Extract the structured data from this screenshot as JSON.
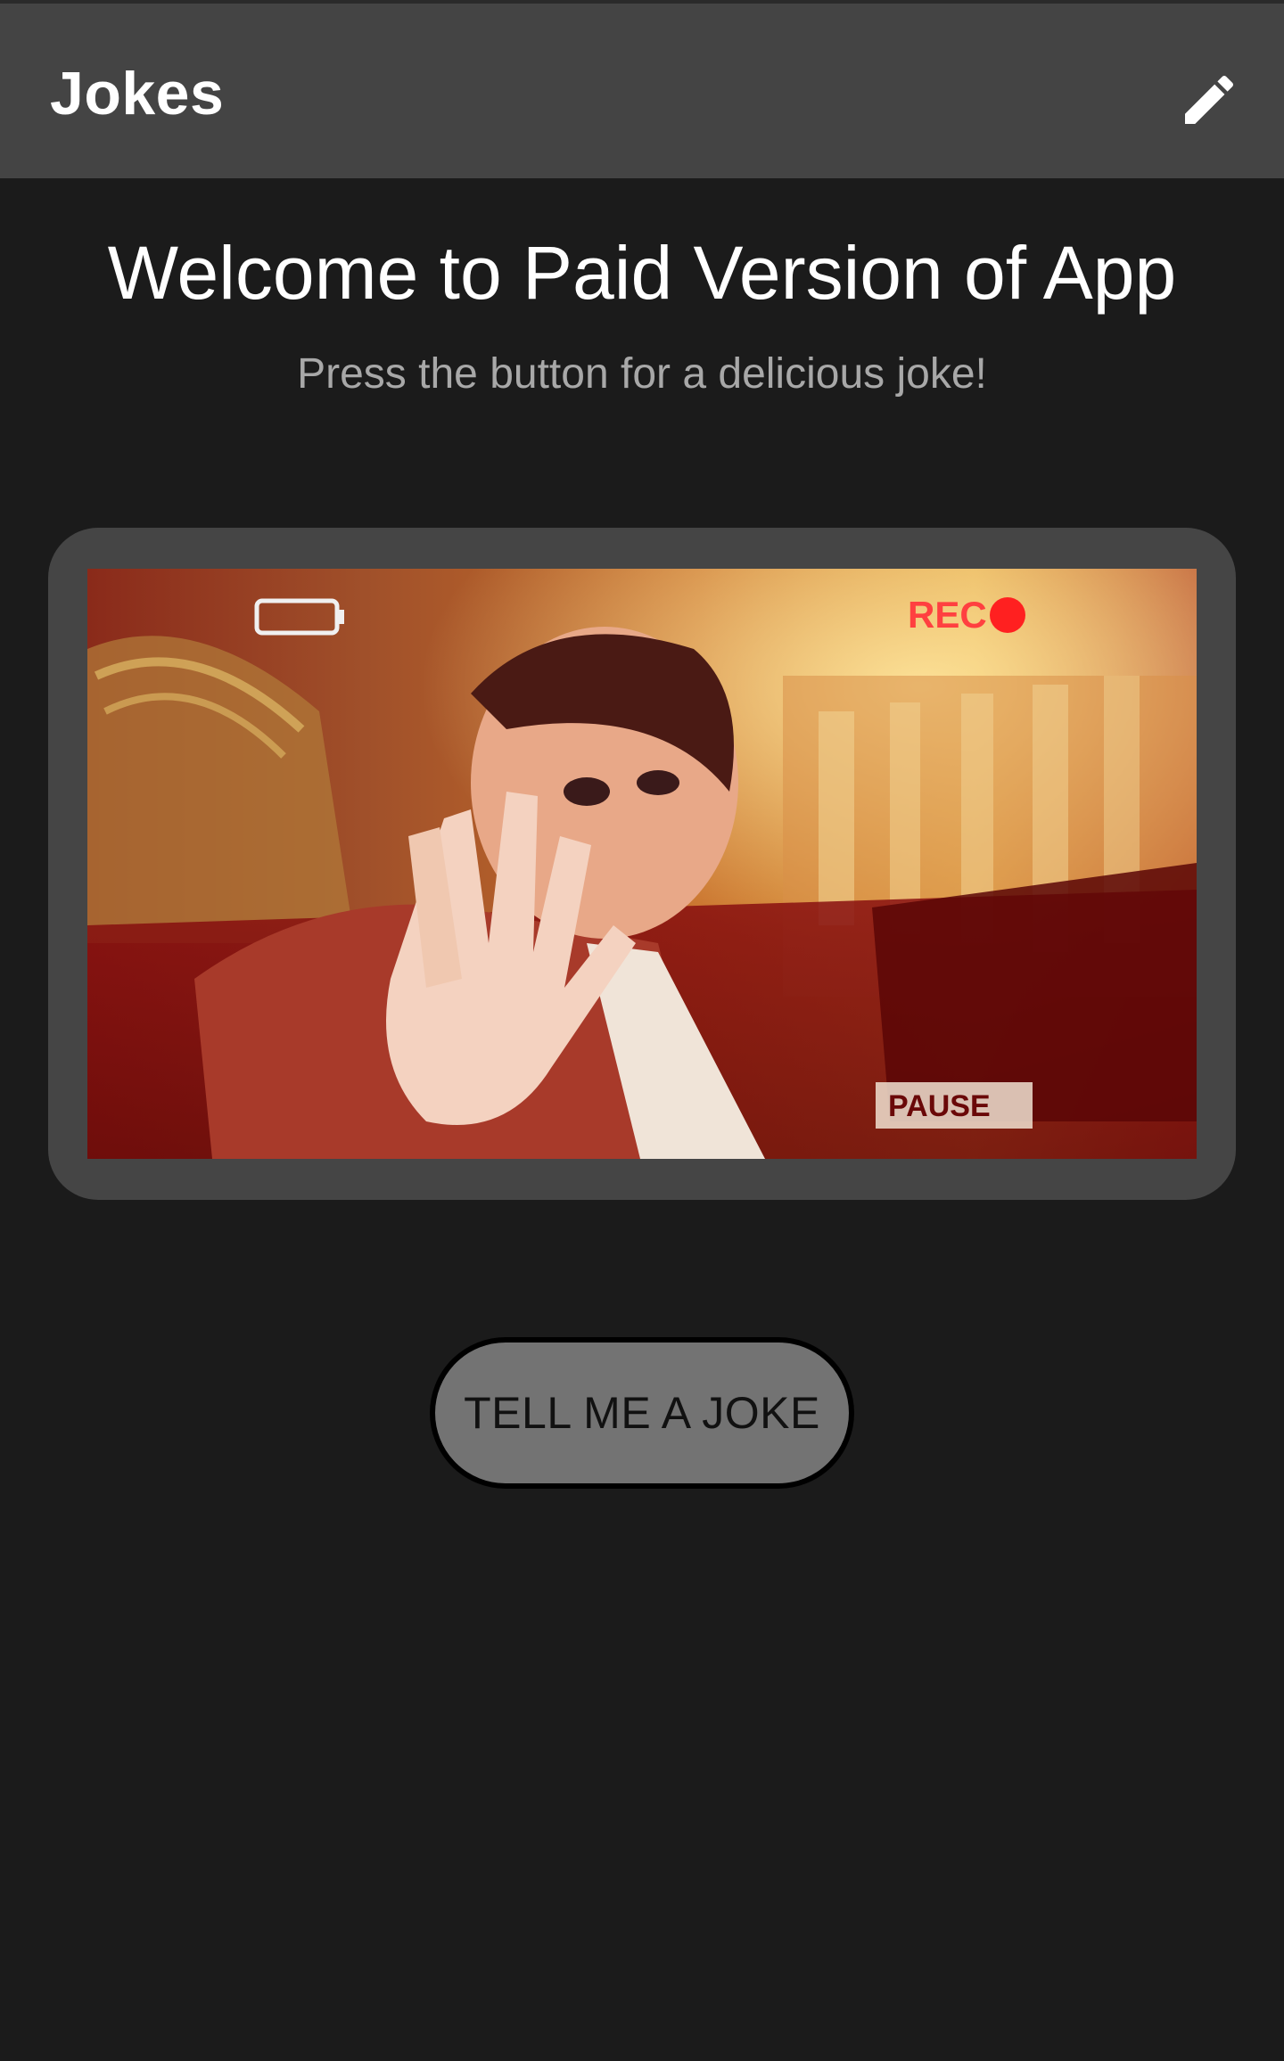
{
  "appbar": {
    "title": "Jokes",
    "edit_icon": "pencil-icon"
  },
  "main": {
    "welcome": "Welcome to Paid Version of App",
    "subtitle": "Press the button for a delicious joke!",
    "image": {
      "description_icon": "joke-gif",
      "overlay_rec_label": "REC",
      "overlay_paused_label": "PAUSE"
    },
    "button_label": "TELL ME A JOKE"
  },
  "colors": {
    "background": "#1b1b1b",
    "appbar": "#444444",
    "card": "#454545",
    "button": "#737373",
    "text_primary": "#ffffff",
    "text_secondary": "#a8a8a8"
  }
}
